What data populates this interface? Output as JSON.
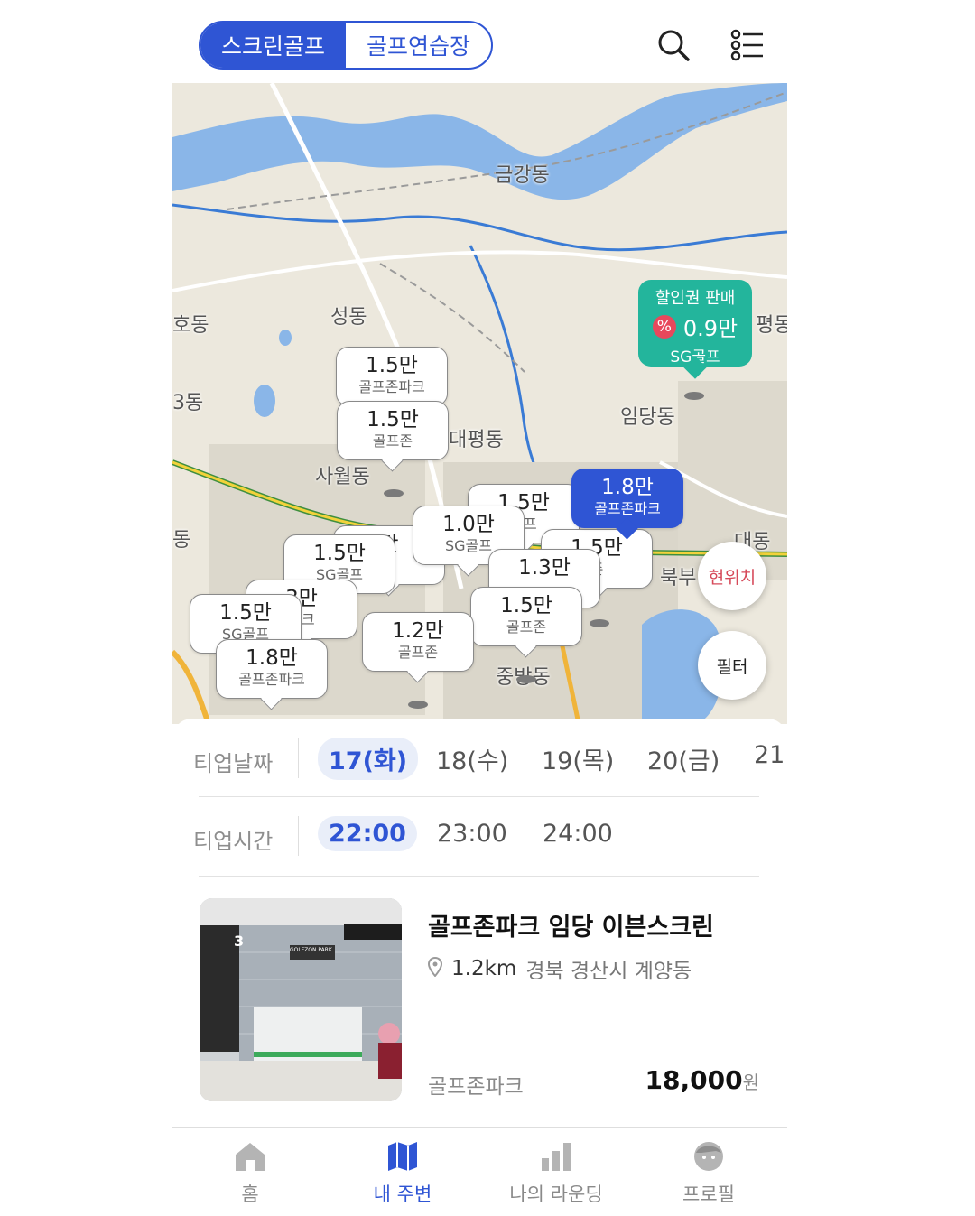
{
  "header": {
    "segment": [
      "스크린골프",
      "골프연습장"
    ],
    "search_icon": "search-icon",
    "menu_icon": "list-menu-icon"
  },
  "map": {
    "area_labels": [
      "금강동",
      "성동",
      "임당동",
      "대평동",
      "사월동",
      "북부",
      "중방동",
      "대동",
      "3동",
      "호동",
      "동",
      "평동"
    ],
    "promo": {
      "badge": "할인권 판매",
      "percent": "%",
      "price": "0.9만",
      "name": "SG골프"
    },
    "pins": [
      {
        "price": "1.5만",
        "name": "골프존파크"
      },
      {
        "price": "1.5만",
        "name": "골프존"
      },
      {
        "price": "1.8만",
        "name": "골프존파크"
      },
      {
        "price": "1.5만",
        "name": "골프"
      },
      {
        "price": "1.0만",
        "name": "SG골프"
      },
      {
        "price": "1.5만",
        "name": "SG골프"
      },
      {
        "price": "만",
        "name": "존"
      },
      {
        "price": "1.3만",
        "name": ""
      },
      {
        "price": "1.5만",
        "name": "존"
      },
      {
        "price": "1.5만",
        "name": "골프존"
      },
      {
        "price": "3만",
        "name": "파크"
      },
      {
        "price": "1.5만",
        "name": "SG골프"
      },
      {
        "price": "1.8만",
        "name": "골프존파크"
      },
      {
        "price": "1.2만",
        "name": "골프존"
      }
    ],
    "current_location": "현위치",
    "filter": "필터"
  },
  "teeup": {
    "date_label": "티업날짜",
    "dates": [
      "17(화)",
      "18(수)",
      "19(목)",
      "20(금)",
      "21"
    ],
    "time_label": "티업시간",
    "times": [
      "22:00",
      "23:00",
      "24:00"
    ]
  },
  "listing": {
    "title": "골프존파크 임당 이븐스크린",
    "distance": "1.2km",
    "address": "경북 경산시 계양동",
    "brand": "골프존파크",
    "price": "18,000",
    "unit": "원",
    "photo_sign": "GOLFZON PARK",
    "photo_floor": "3"
  },
  "tabbar": {
    "items": [
      {
        "label": "홈",
        "icon": "home-icon"
      },
      {
        "label": "내 주변",
        "icon": "map-icon"
      },
      {
        "label": "나의 라운딩",
        "icon": "bar-chart-icon"
      },
      {
        "label": "프로필",
        "icon": "profile-icon"
      }
    ],
    "active": "내 주변"
  },
  "colors": {
    "accent": "#2f55d4",
    "promo": "#23b59c",
    "current_location_text": "#d64a5a"
  }
}
